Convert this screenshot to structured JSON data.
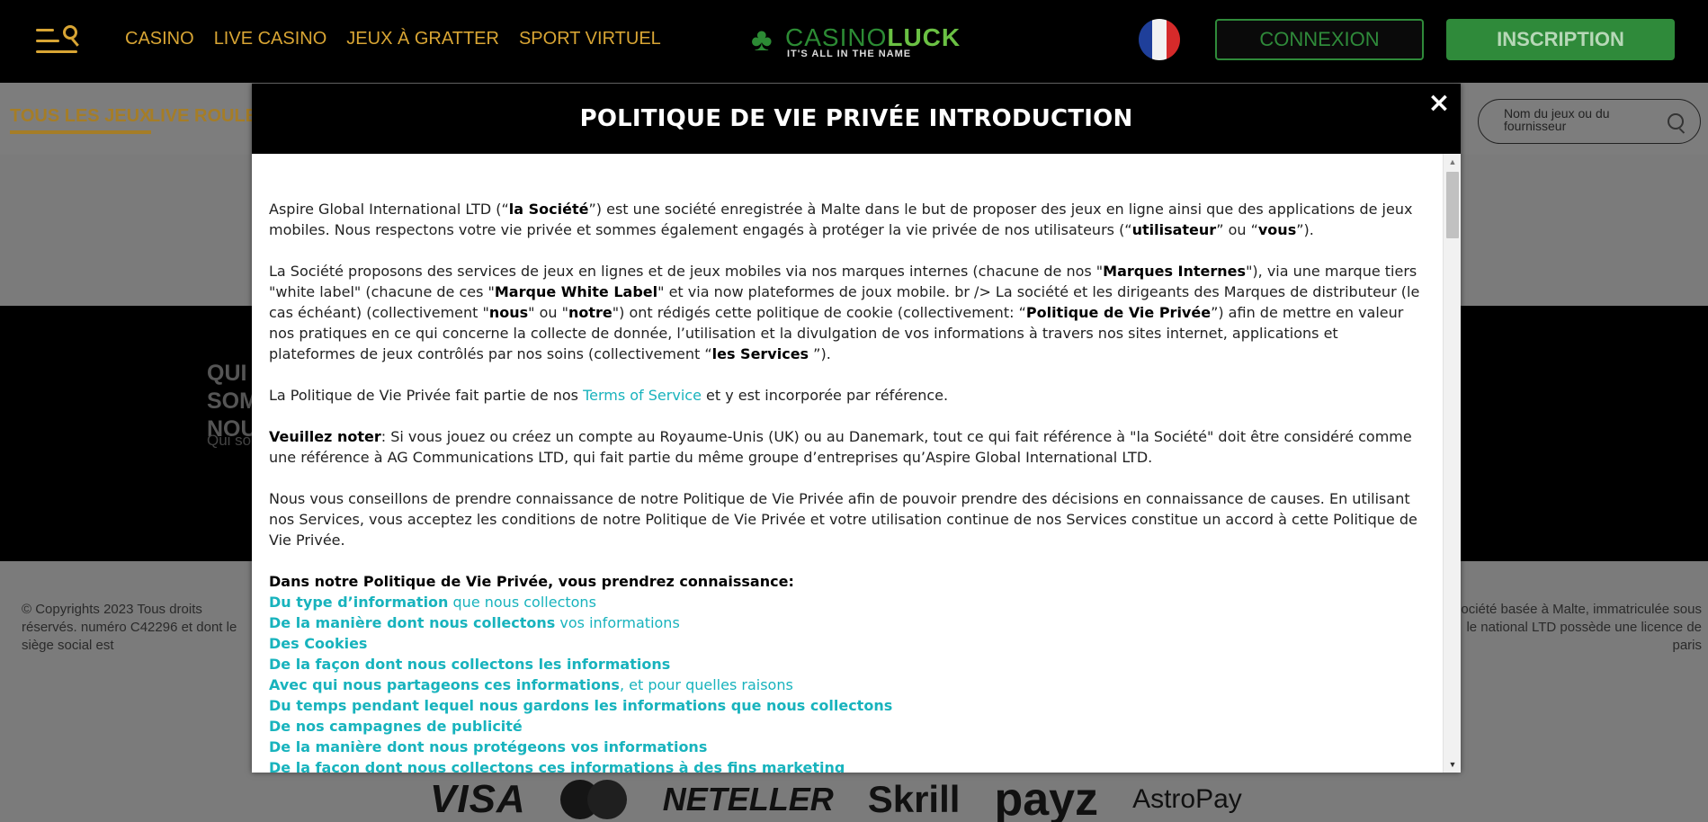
{
  "header": {
    "nav": [
      "CASINO",
      "LIVE CASINO",
      "JEUX À GRATTER",
      "SPORT VIRTUEL"
    ],
    "logo_casino": "CASINO",
    "logo_luck": "LUCK",
    "logo_tagline": "IT'S ALL IN THE NAME",
    "language_flag": "france-flag",
    "login_label": "CONNEXION",
    "signup_label": "INSCRIPTION"
  },
  "subnav": {
    "tab_all": "TOUS LES JEUX",
    "tab_roulette": "LIVE ROULETTE",
    "search_placeholder": "Nom du jeux ou du fournisseur"
  },
  "about": {
    "title": "QUI SOMMES NOUS",
    "text": "Qui sommes nous"
  },
  "footer": {
    "copyright_left": "© Copyrights 2023 Tous droits réservés. numéro C42296 et dont le siège social est",
    "copyright_right": "société basée à Malte, immatriculée sous le national LTD possède une licence de paris",
    "payments": [
      "VISA",
      "mastercard",
      "NETELLER",
      "Skrill",
      "payz",
      "AstroPay"
    ]
  },
  "modal": {
    "title": "POLITIQUE DE VIE PRIVÉE INTRODUCTION",
    "close_label": "×",
    "p1": {
      "a": "Aspire Global International LTD (“",
      "b": "la Société",
      "c": "”) est une société enregistrée à Malte dans le but de proposer des jeux en ligne ainsi que des applications de jeux mobiles. Nous respectons votre vie privée et sommes également engagés à protéger la vie privée de nos utilisateurs (“",
      "d": "utilisateur",
      "e": "” ou “",
      "f": "vous",
      "g": "”)."
    },
    "p2": {
      "a": "La Société proposons des services de jeux en lignes et de jeux mobiles via nos marques internes (chacune de nos \"",
      "b": "Marques Internes",
      "c": "\"), via une marque tiers \"white label\" (chacune de ces \"",
      "d": "Marque White Label",
      "e": "\" et via now plateformes de joux mobile. br /> La société et les dirigeants des Marques de distributeur (le cas échéant) (collectivement \"",
      "f": "nous",
      "g": "\" ou \"",
      "h": "notre",
      "i": "\") ont rédigés cette politique de cookie (collectivement: “",
      "j": "Politique de Vie Privée",
      "k": "”) afin de mettre en valeur nos pratiques en ce qui concerne la collecte de donnée, l’utilisation et la divulgation de vos informations à travers nos sites internet, applications et plateformes de jeux contrôlés par nos soins (collectivement “",
      "l": "les Services",
      "m": " ”)."
    },
    "p3": {
      "a": "La Politique de Vie Privée fait partie de nos ",
      "link": "Terms of Service",
      "b": " et y est incorporée par référence."
    },
    "p4": {
      "bold": "Veuillez noter",
      "text": ": Si vous jouez ou créez un compte au Royaume-Unis (UK) ou au Danemark, tout ce qui fait référence à \"la Société\" doit être considéré comme une référence à AG Communications LTD, qui fait partie du même groupe d’entreprises qu’Aspire Global International LTD."
    },
    "p5": "Nous vous conseillons de prendre connaissance de notre Politique de Vie Privée afin de pouvoir prendre des décisions en connaissance de causes. En utilisant nos Services, vous acceptez les conditions de notre Politique de Vie Privée et votre utilisation continue de nos Services constitue un accord à cette Politique de Vie Privée.",
    "toc_heading": "Dans notre Politique de Vie Privée, vous prendrez connaissance:",
    "toc": [
      {
        "bold": "Du type d’information",
        "rest": " que nous collectons"
      },
      {
        "bold": "De la manière dont nous collectons",
        "rest": " vos informations"
      },
      {
        "bold": "Des Cookies",
        "rest": ""
      },
      {
        "bold": "De la façon dont nous collectons les informations",
        "rest": ""
      },
      {
        "bold": "Avec qui nous partageons ces informations",
        "rest": ", et pour quelles raisons"
      },
      {
        "bold": "Du temps pendant lequel nous gardons les informations que nous collectons",
        "rest": ""
      },
      {
        "bold": "De nos campagnes de publicité",
        "rest": ""
      },
      {
        "bold": "De la manière dont nous protégeons vos informations",
        "rest": ""
      },
      {
        "bold": "De la façon dont nous collectons ces informations à des fins marketing",
        "rest": ""
      }
    ]
  },
  "colors": {
    "gold": "#d8a534",
    "green": "#2f8a3a",
    "link": "#18b3bd"
  }
}
